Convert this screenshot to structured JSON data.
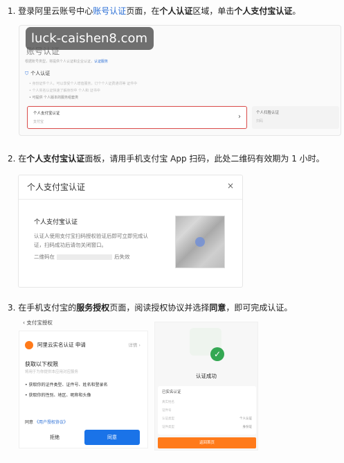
{
  "steps": {
    "s1": {
      "num": "1.",
      "a": "登录阿里云账号中心",
      "link": "账号认证",
      "b": "页面，在",
      "b1": "个人认证",
      "c": "区域，单击",
      "c1": "个人支付宝认证",
      "d": "。"
    },
    "s2": {
      "num": "2.",
      "a": "在",
      "a1": "个人支付宝认证",
      "b": "面板，请用手机支付宝 App 扫码，此处二维码有效期为 1 小时。"
    },
    "s3": {
      "num": "3.",
      "a": "在手机支付宝的",
      "a1": "服务授权",
      "b": "页面，阅读授权协议并选择",
      "b1": "同意",
      "c": "，即可完成认证。"
    }
  },
  "watermark": "luck-caishen8.com",
  "shot1": {
    "title": "账号认证",
    "sub_text": "根据账号类型，将提供个人认证和企业认证，",
    "sub_link": "认证服务",
    "personal_header": "个人认证",
    "bullet1": "• 身份证件个人，可以享受个人增值服务，订个个人证费通讯等 证件中",
    "bullet2": "• 个人实名认证快速了解身份中 个人和 证书中",
    "bullet3": "• 可提供 个人版本的服务组套类",
    "alipay_title": "个人支付宝认证",
    "alipay_sub": "支付宝",
    "face_title": "个人扫脸认证",
    "face_sub": "扫码"
  },
  "shot2": {
    "title": "个人支付宝认证",
    "close": "×",
    "sub": "个人支付宝认证",
    "desc1": "认证人使用支付宝扫码授权验证后即可立即完成认",
    "desc2": "证，扫码成功后请勿关闭窗口。",
    "exp_a": "二维码在",
    "exp_b": "后失效"
  },
  "shot3": {
    "back": "‹  支付宝授权",
    "app_name": "阿里云实名认证  申请",
    "detail": "详情 ›",
    "perm_title": "获取以下权限",
    "perm_sub": "将用于为你提供本应用对应服务",
    "perm1": "• 获取你的证件类型、证件号、姓名和登录名",
    "perm2": "• 获取你的性别、地区、昵称和头像",
    "agree_a": "同意",
    "agree_link": "《用户授权协议》",
    "reject": "拒绝",
    "accept": "同意",
    "success_title": "认证成功",
    "card_head": "已实名认证",
    "rows": [
      {
        "k": "真实姓名",
        "v": ""
      },
      {
        "k": "证件号",
        "v": ""
      },
      {
        "k": "认证类型",
        "v": "个人认证"
      },
      {
        "k": "证件类型",
        "v": "身份证"
      }
    ],
    "done": "返回首页"
  }
}
